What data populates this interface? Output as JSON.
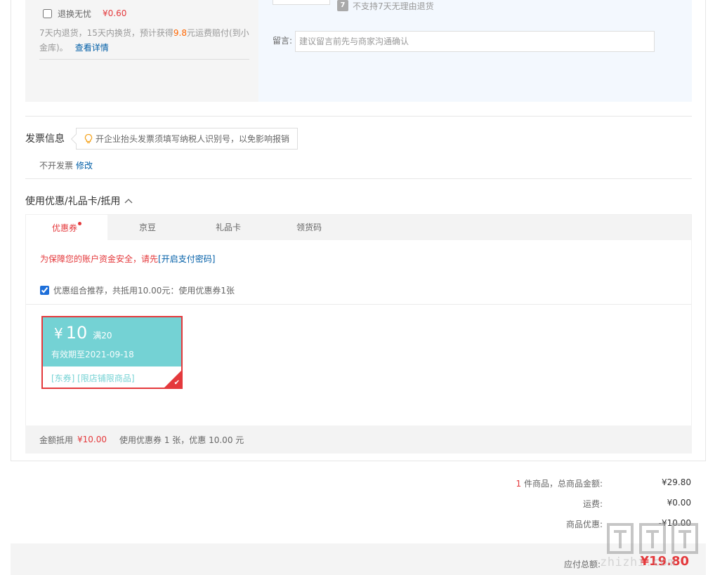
{
  "service": {
    "name": "退换无忧",
    "price": "¥0.60",
    "desc_prefix": "7天内退货，15天内换货，预计获得",
    "desc_highlight": "9.8",
    "desc_suffix": "元运费赔付(到小金库)。",
    "detail_link": "查看详情"
  },
  "product": {
    "no7_icon": "7",
    "no7_text": "不支持7天无理由退货",
    "message_label": "留言:",
    "message_placeholder": "建议留言前先与商家沟通确认"
  },
  "invoice": {
    "title": "发票信息",
    "tip": "开企业抬头发票须填写纳税人识别号，以免影响报销",
    "status": "不开发票",
    "modify_link": "修改"
  },
  "coupons": {
    "section_title": "使用优惠/礼品卡/抵用",
    "tabs": [
      {
        "label": "优惠券"
      },
      {
        "label": "京豆"
      },
      {
        "label": "礼品卡"
      },
      {
        "label": "领货码"
      }
    ],
    "security_tip": "为保障您的账户资金安全，请先",
    "security_link": "[开启支付密码]",
    "combo_text": "优惠组合推荐，共抵用10.00元：使用优惠券1张",
    "card": {
      "yen": "¥",
      "amount": "10",
      "condition": "满20",
      "expire": "有效期至2021-09-18",
      "tags": "[东券]  [限店铺限商品]"
    },
    "summary_label": "金额抵用",
    "summary_amount": "¥10.00",
    "summary_text": "使用优惠券 1 张，优惠 10.00 元"
  },
  "totals": {
    "count": "1",
    "count_label": " 件商品，总商品金额:",
    "goods_total": "¥29.80",
    "shipping_label": "运费:",
    "shipping": "¥0.00",
    "discount_label": "商品优惠:",
    "discount": "-¥10.00",
    "pay_label": "应付总额:",
    "pay_total": "¥19.80"
  },
  "watermark": {
    "text": "zhizhi.com"
  },
  "colors": {
    "accent_red": "#e4393c",
    "link_blue": "#005ea7",
    "coupon_teal": "#74d2d4",
    "highlight_orange": "#ff6600"
  }
}
